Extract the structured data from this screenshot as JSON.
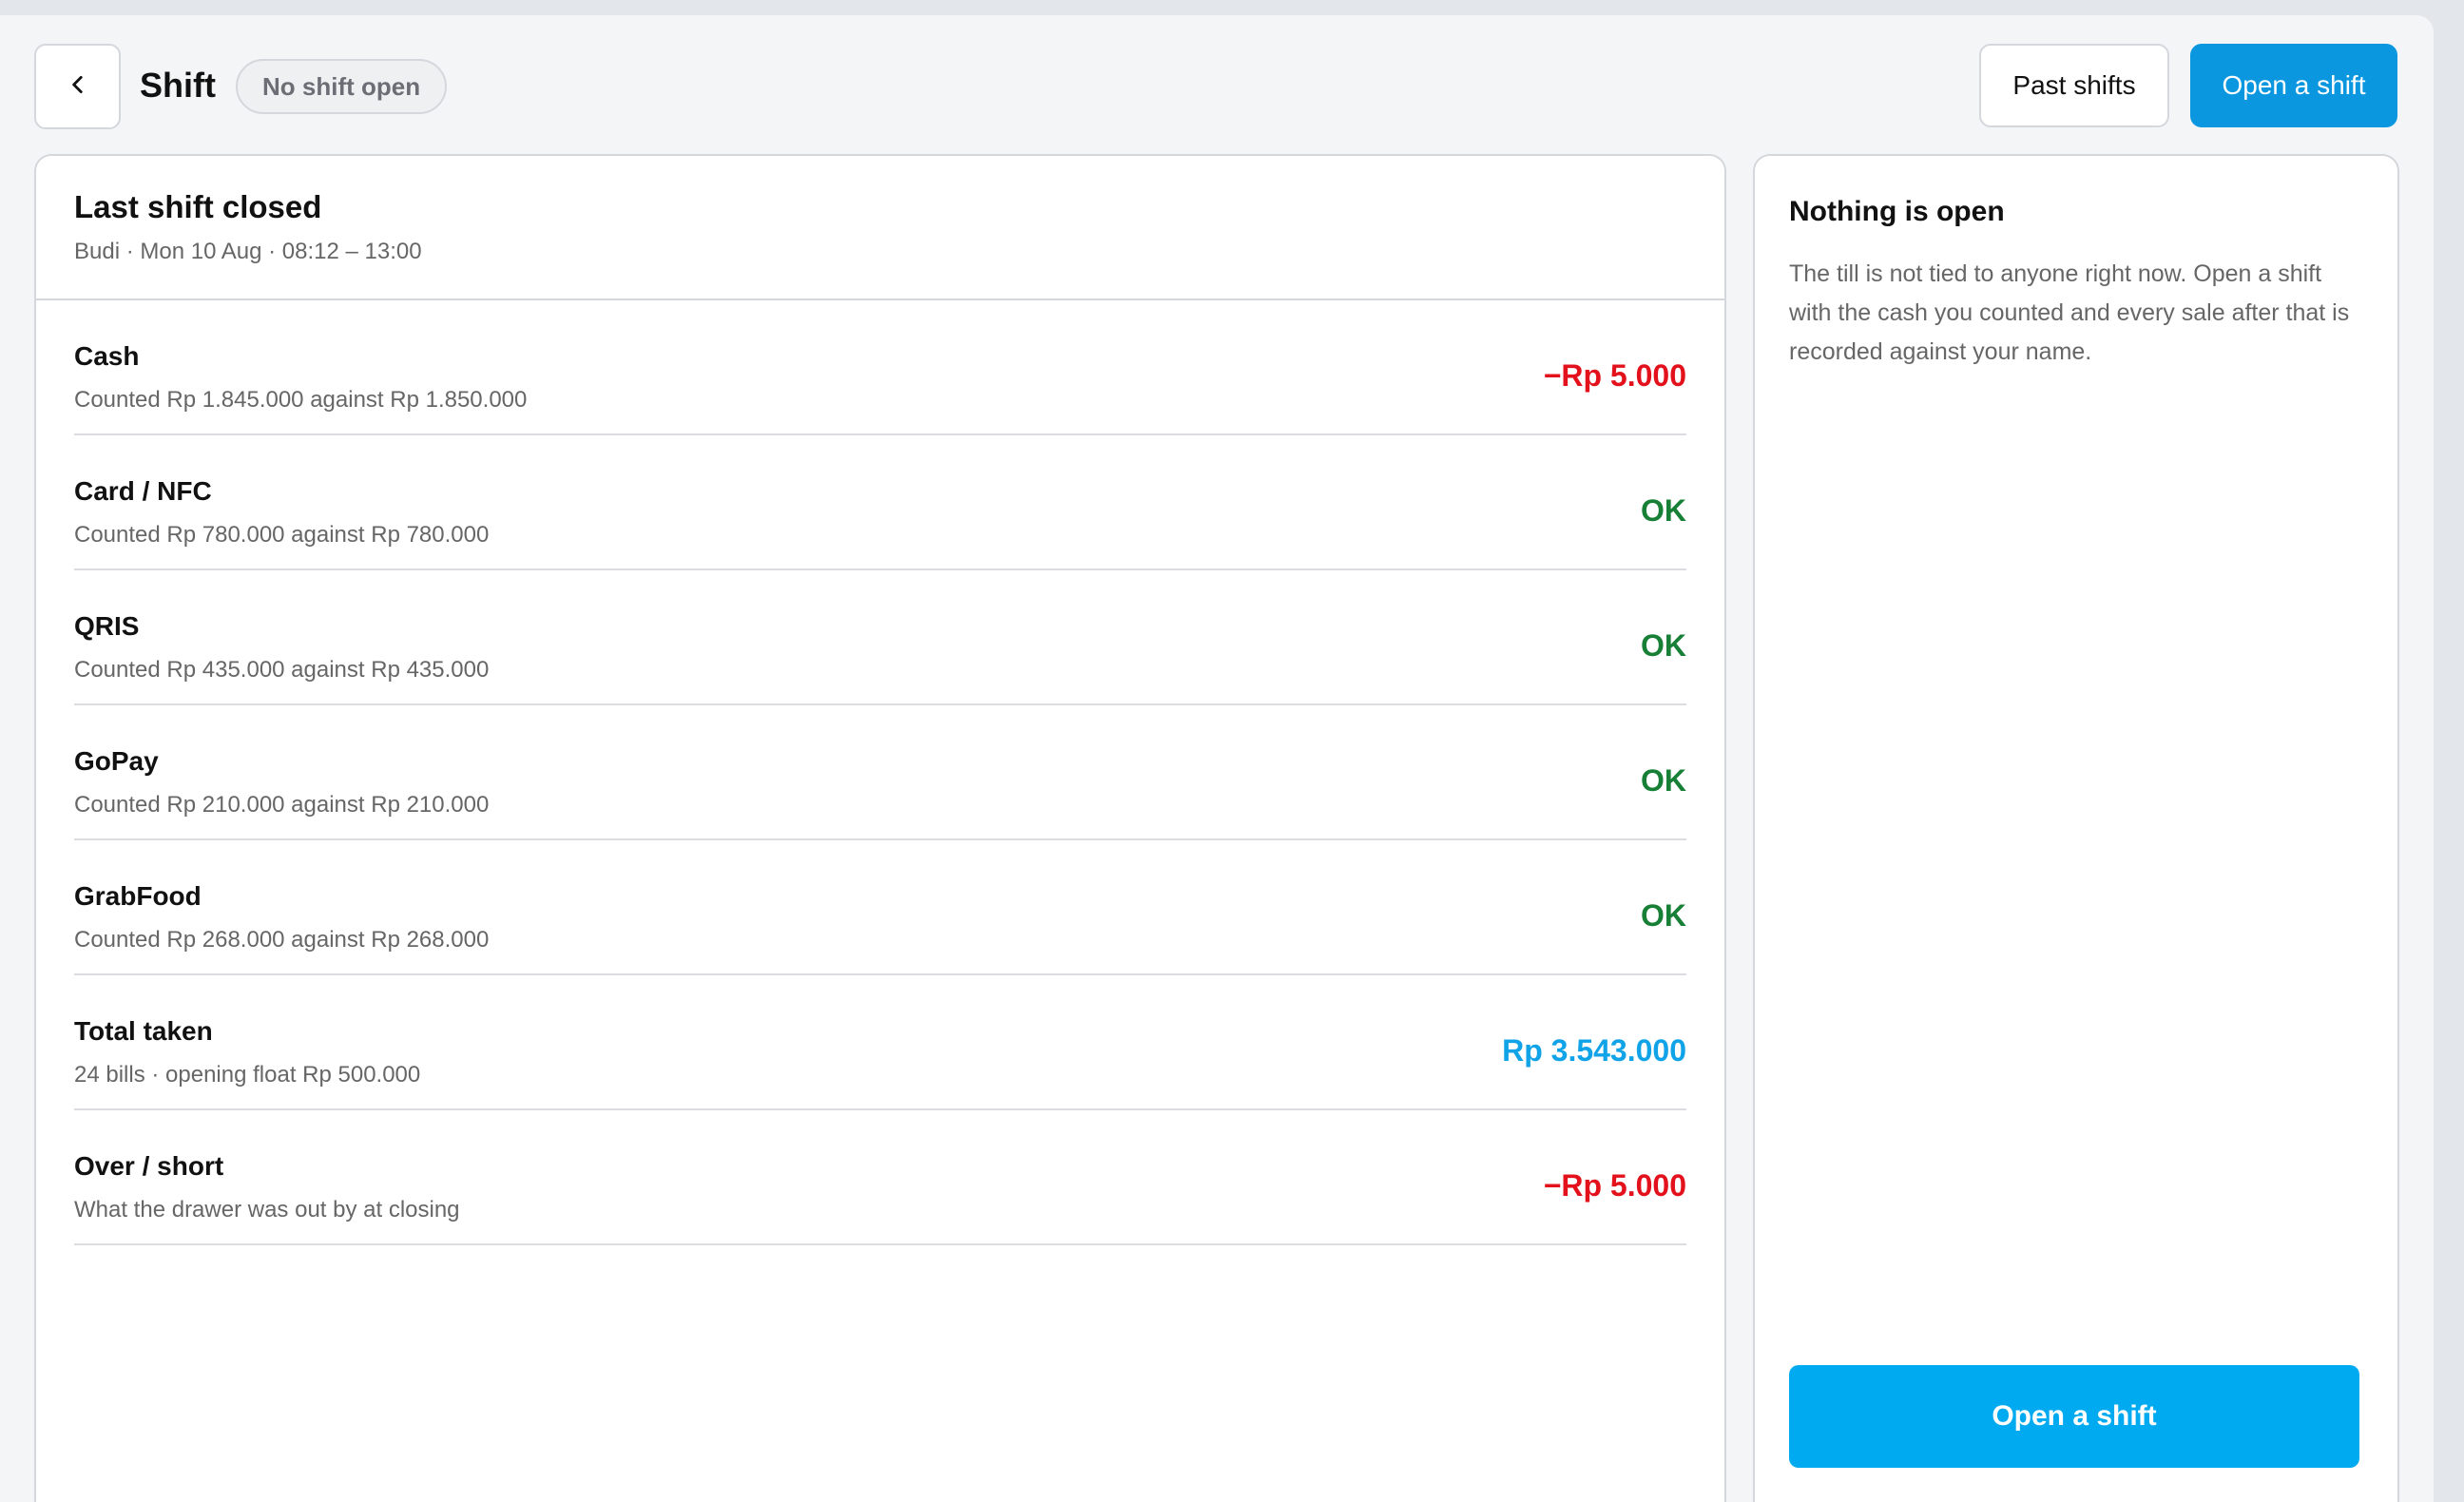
{
  "header": {
    "title": "Shift",
    "status_badge": "No shift open",
    "past_shifts_label": "Past shifts",
    "open_shift_label": "Open a shift"
  },
  "main": {
    "title": "Last shift closed",
    "subtitle": "Budi · Mon 10 Aug · 08:12 – 13:00",
    "rows": [
      {
        "label": "Cash",
        "detail": "Counted Rp 1.845.000 against Rp 1.850.000",
        "value": "−Rp 5.000"
      },
      {
        "label": "Card / NFC",
        "detail": "Counted Rp 780.000 against Rp 780.000",
        "value": "OK"
      },
      {
        "label": "QRIS",
        "detail": "Counted Rp 435.000 against Rp 435.000",
        "value": "OK"
      },
      {
        "label": "GoPay",
        "detail": "Counted Rp 210.000 against Rp 210.000",
        "value": "OK"
      },
      {
        "label": "GrabFood",
        "detail": "Counted Rp 268.000 against Rp 268.000",
        "value": "OK"
      },
      {
        "label": "Total taken",
        "detail": "24 bills · opening float Rp 500.000",
        "value": "Rp 3.543.000"
      },
      {
        "label": "Over / short",
        "detail": "What the drawer was out by at closing",
        "value": "−Rp 5.000"
      }
    ]
  },
  "side": {
    "title": "Nothing is open",
    "description": "The till is not tied to anyone right now. Open a shift with the cash you counted and every sale after that is recorded against your name.",
    "open_shift_label": "Open a shift"
  },
  "colors": {
    "negative": "#e3111b",
    "ok": "#178036",
    "total": "#11a3e8",
    "accent": "#0a97e0"
  },
  "icons": {
    "back": "chevron-left-icon"
  }
}
